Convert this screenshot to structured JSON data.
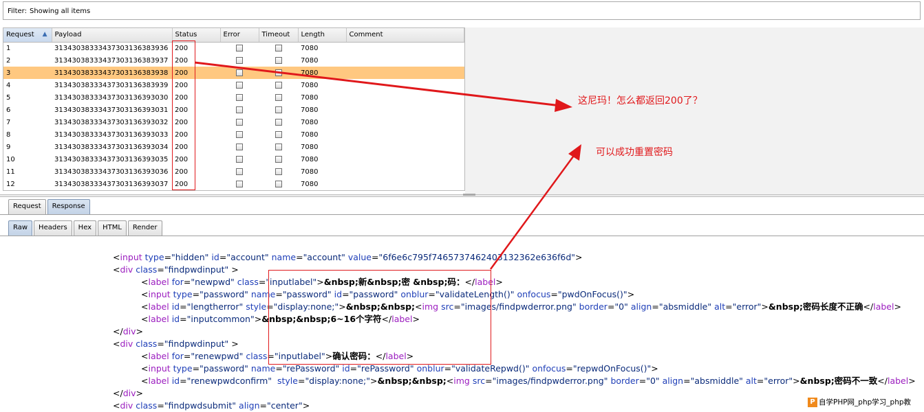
{
  "filter": {
    "label": "Filter:",
    "text": "Showing all items"
  },
  "table": {
    "columns": [
      "Request",
      "Payload",
      "Status",
      "Error",
      "Timeout",
      "Length",
      "Comment"
    ],
    "rows": [
      {
        "request": "1",
        "payload": "313430383334373031363839 36",
        "status": "200",
        "length": "7080"
      },
      {
        "request": "2",
        "payload": "31343038333437303136383937",
        "status": "200",
        "length": "7080"
      },
      {
        "request": "3",
        "payload": "31343038333437303136383938",
        "status": "200",
        "length": "7080"
      },
      {
        "request": "4",
        "payload": "31343038333437303136383939",
        "status": "200",
        "length": "7080"
      },
      {
        "request": "5",
        "payload": "31343038333437303136393030",
        "status": "200",
        "length": "7080"
      },
      {
        "request": "6",
        "payload": "31343038333437303136393031",
        "status": "200",
        "length": "7080"
      },
      {
        "request": "7",
        "payload": "31343038333437303136393032",
        "status": "200",
        "length": "7080"
      },
      {
        "request": "8",
        "payload": "31343038333437303136393033",
        "status": "200",
        "length": "7080"
      },
      {
        "request": "9",
        "payload": "31343038333437303136393034",
        "status": "200",
        "length": "7080"
      },
      {
        "request": "10",
        "payload": "31343038333437303136393035",
        "status": "200",
        "length": "7080"
      },
      {
        "request": "11",
        "payload": "31343038333437303136393036",
        "status": "200",
        "length": "7080"
      },
      {
        "request": "12",
        "payload": "31343038333437303136393037",
        "status": "200",
        "length": "7080"
      }
    ],
    "selected_row": "3"
  },
  "outer_tabs": [
    "Request",
    "Response"
  ],
  "inner_tabs": [
    "Raw",
    "Headers",
    "Hex",
    "HTML",
    "Render"
  ],
  "annotations": {
    "note1": "这尼玛！怎么都返回200了？",
    "note2": "可以成功重置密码"
  },
  "watermark": "自学PHP网_php学习_php教",
  "colors": {
    "accent_red": "#e0181b",
    "selected_row": "#ffc880"
  }
}
